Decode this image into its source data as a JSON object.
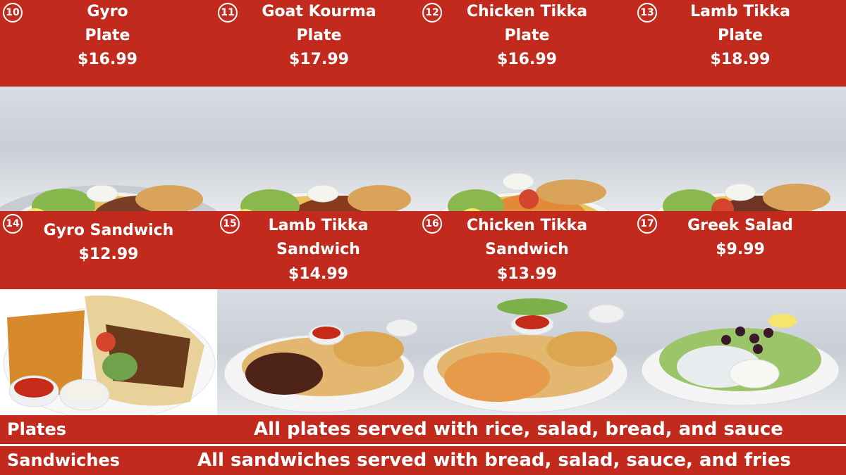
{
  "top_items": [
    {
      "number": "10",
      "name": "Gyro\nPlate",
      "price": "$16.99"
    },
    {
      "number": "11",
      "name": "Goat Kourma\nPlate",
      "price": "$17.99"
    },
    {
      "number": "12",
      "name": "Chicken Tikka\nPlate",
      "price": "$16.99"
    },
    {
      "number": "13",
      "name": "Lamb Tikka\nPlate",
      "price": "$18.99"
    }
  ],
  "bottom_items": [
    {
      "number": "14",
      "name": "Gyro Sandwich",
      "price": "$12.99"
    },
    {
      "number": "15",
      "name": "Lamb Tikka\nSandwich",
      "price": "$14.99"
    },
    {
      "number": "16",
      "name": "Chicken Tikka\nSandwich",
      "price": "$13.99"
    },
    {
      "number": "17",
      "name": "Greek Salad",
      "price": "$9.99"
    }
  ],
  "footer": {
    "plates_label": "Plates",
    "plates_text": "All plates served with rice, salad, bread, and sauce",
    "sandwiches_label": "Sandwiches",
    "sandwiches_text": "All sandwiches served with bread, salad, sauce, and fries"
  },
  "colors": {
    "band": "#c22a1e",
    "text": "#ffffff"
  }
}
